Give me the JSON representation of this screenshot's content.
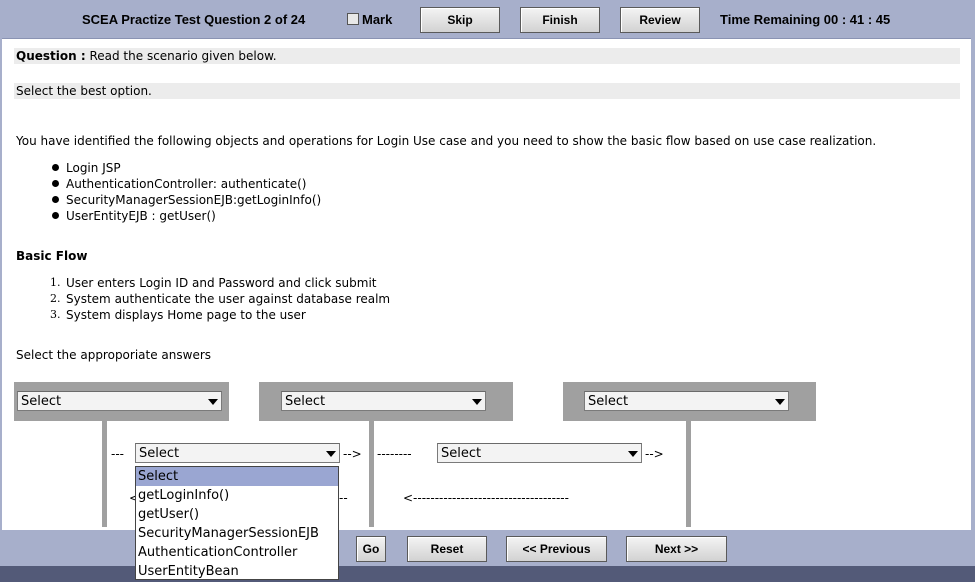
{
  "header": {
    "title": "SCEA Practize Test Question 2 of 24",
    "mark_label": "Mark",
    "skip_label": "Skip",
    "finish_label": "Finish",
    "review_label": "Review",
    "time_remaining": "Time Remaining 00 : 41 : 45"
  },
  "question": {
    "label": "Question :",
    "intro": "Read the scenario given below.",
    "instruction": "Select the best option.",
    "scenario": "You have identified the following objects and operations for Login Use case and you need to show the basic flow based on use case realization.",
    "objects": [
      "Login JSP",
      "AuthenticationController: authenticate()",
      "SecurityManagerSessionEJB:getLoginInfo()",
      "UserEntityEJB : getUser()"
    ],
    "basic_flow_title": "Basic Flow",
    "basic_flow_numbers": [
      "1.",
      "2.",
      "3."
    ],
    "basic_flow": [
      "User enters Login ID and Password and click submit",
      "System authenticate the user against database realm",
      "System displays Home page to the user"
    ],
    "select_prompt": "Select the approporiate answers"
  },
  "diagram": {
    "object1_value": "Select",
    "object2_value": "Select",
    "object3_value": "Select",
    "message1_value": "Select",
    "message2_value": "Select",
    "arrow_lead": "---",
    "arrow1_tail": "-->",
    "arrow2_lead": "--------",
    "arrow2_tail": "-->",
    "return1_head": "<",
    "return1_tail": "--",
    "return2": "<------------------------------------"
  },
  "dropdown": {
    "options": [
      "Select",
      "getLoginInfo()",
      "getUser()",
      "SecurityManagerSessionEJB",
      "AuthenticationController",
      "UserEntityBean"
    ],
    "highlighted_index": 0
  },
  "footer": {
    "go_label": "Go",
    "reset_label": "Reset",
    "previous_label": "<< Previous",
    "next_label": "Next >>"
  },
  "colors": {
    "bar": "#a7afcb",
    "lane": "#a0a0a0",
    "highlight": "#9aa6d2"
  }
}
